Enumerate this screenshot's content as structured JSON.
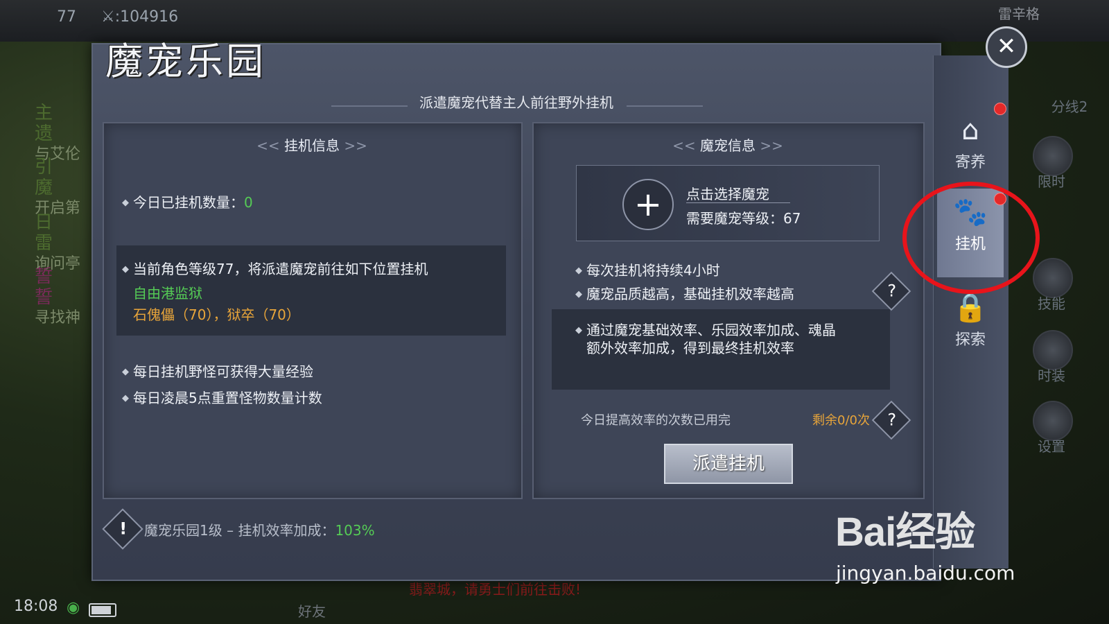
{
  "background": {
    "level": "77",
    "power": "⚔:104916",
    "top_right_name": "雷辛格",
    "left_items": [
      {
        "big": "主 遗",
        "small": "与艾伦"
      },
      {
        "big": "引 魔",
        "small": "开启第"
      },
      {
        "big": "日 雷",
        "small": "询问亭"
      },
      {
        "big": "誓 誓",
        "small": "寻找神"
      }
    ],
    "right_labels": [
      "分线2",
      "限时",
      "技能",
      "时装",
      "设置"
    ],
    "time": "18:08",
    "friend_label": "好友",
    "chat_line2": "翡翠城，请勇士们前往击败!"
  },
  "panel": {
    "title": "魔宠乐园",
    "subtitle": "派遣魔宠代替主人前往野外挂机",
    "left_card": {
      "header": "挂机信息",
      "today_count_label": "今日已挂机数量：",
      "today_count_value": "0",
      "location_intro": "当前角色等级77，将派遣魔宠前往如下位置挂机",
      "location_name": "自由港监狱",
      "monsters": "石傀儡（70），狱卒（70）",
      "tip1": "每日挂机野怪可获得大量经验",
      "tip2": "每日凌晨5点重置怪物数量计数"
    },
    "right_card": {
      "header": "魔宠信息",
      "select_label": "点击选择魔宠",
      "required_level_label": "需要魔宠等级：",
      "required_level_value": "67",
      "info1": "每次挂机将持续4小时",
      "info2": "魔宠品质越高，基础挂机效率越高",
      "info3_line1": "通过魔宠基础效率、乐园效率加成、魂晶",
      "info3_line2": "额外效率加成，得到最终挂机效率",
      "boost_text": "今日提高效率的次数已用完",
      "remaining": "剩余0/0次",
      "dispatch_button": "派遣挂机"
    },
    "footer": {
      "label": "魔宠乐园1级 – 挂机效率加成：",
      "value": "103%"
    }
  },
  "sidebar": {
    "tabs": [
      {
        "label": "寄养",
        "icon": "house-icon"
      },
      {
        "label": "挂机",
        "icon": "paw-icon"
      },
      {
        "label": "探索",
        "icon": "lock-icon"
      }
    ]
  },
  "watermark": {
    "brand": "Bai经验",
    "url": "jingyan.baidu.com"
  },
  "colors": {
    "highlight_circle": "#e8141b",
    "green_value": "#55cc55",
    "orange_value": "#e8a53a"
  }
}
